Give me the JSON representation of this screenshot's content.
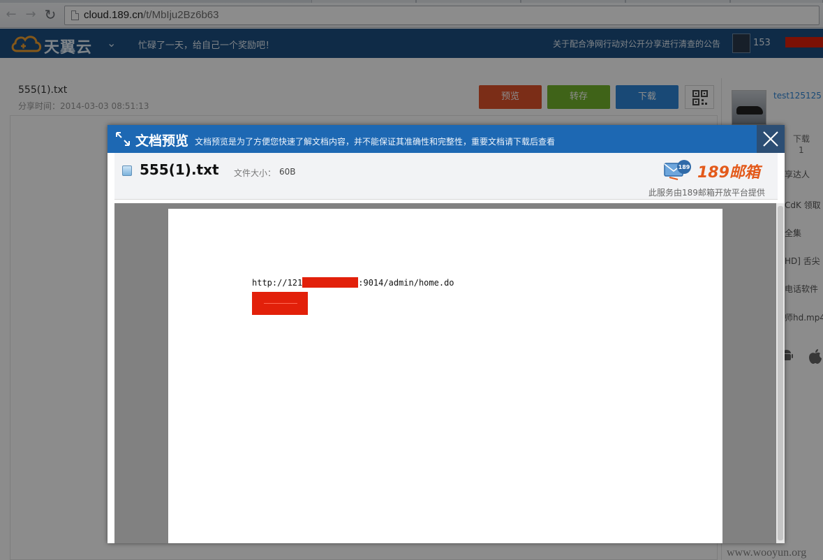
{
  "browser": {
    "url_host": "cloud.189.cn",
    "url_path": "/t/MbIju2Bz6b63"
  },
  "site_header": {
    "logo_text": "天翼云",
    "slogan": "忙碌了一天，给自己一个奖励吧！",
    "notice": "关于配合净网行动对公开分享进行清查的公告",
    "user": "153"
  },
  "share": {
    "file_name": "555(1).txt",
    "share_time": "分享时间：2014-03-03 08:51:13",
    "buttons": {
      "preview": "预览",
      "save": "转存",
      "download": "下载"
    }
  },
  "sidebar": {
    "username": "test125125",
    "download_label": "下载",
    "download_count": "1",
    "links": [
      "享达人",
      "CdK 领取",
      "全集",
      "HD] 舌尖",
      "电话软件",
      "师hd.mp4"
    ]
  },
  "modal": {
    "title": "文档预览",
    "subtitle": "文档预览是为了方便您快速了解文档内容，并不能保证其准确性和完整性，重要文档请下载后查看",
    "file_name": "555(1).txt",
    "size_label": "文件大小：",
    "size_value": "60B",
    "brand": "189邮箱",
    "brand_badge": "189",
    "provider": "此服务由189邮箱开放平台提供"
  },
  "document": {
    "line1_prefix": "http://121",
    "line1_suffix": ":9014/admin/home.do"
  },
  "watermark": "www.wooyun.org",
  "colors": {
    "header_bg": "#1c4f82",
    "modal_header": "#1d68b3",
    "redaction": "#e2200a",
    "btn_preview": "#e0532b",
    "btn_save": "#74b52c",
    "btn_download": "#2e86d7",
    "brand_orange": "#e35a1b"
  },
  "icons": [
    "back-icon",
    "forward-icon",
    "reload-icon",
    "page-icon",
    "cloud-logo-icon",
    "chevron-down-icon",
    "qr-code-icon",
    "expand-icon",
    "close-icon",
    "document-icon",
    "mail-logo-icon",
    "android-icon",
    "apple-icon"
  ]
}
